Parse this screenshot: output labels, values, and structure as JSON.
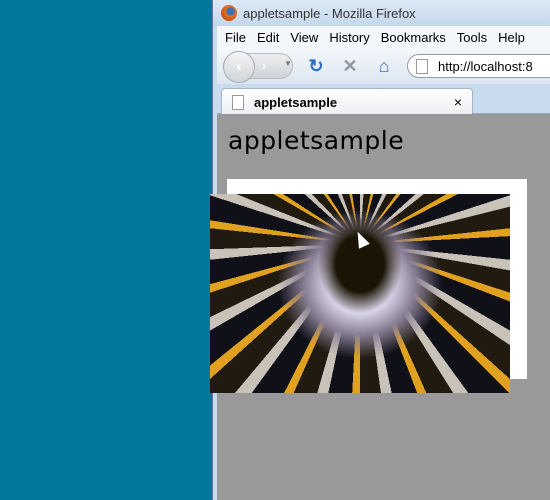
{
  "window": {
    "title": "appletsample - Mozilla Firefox"
  },
  "menu": [
    "File",
    "Edit",
    "View",
    "History",
    "Bookmarks",
    "Tools",
    "Help"
  ],
  "nav": {
    "url": "http://localhost:8",
    "back_icon": "back-arrow",
    "forward_icon": "forward-arrow",
    "reload_icon": "reload",
    "stop_icon": "stop-x",
    "home_icon": "house"
  },
  "tab": {
    "label": "appletsample",
    "close": "×"
  },
  "page": {
    "heading": "appletsample"
  },
  "colors": {
    "desktop": "#03789c",
    "content_bg": "#999999"
  }
}
